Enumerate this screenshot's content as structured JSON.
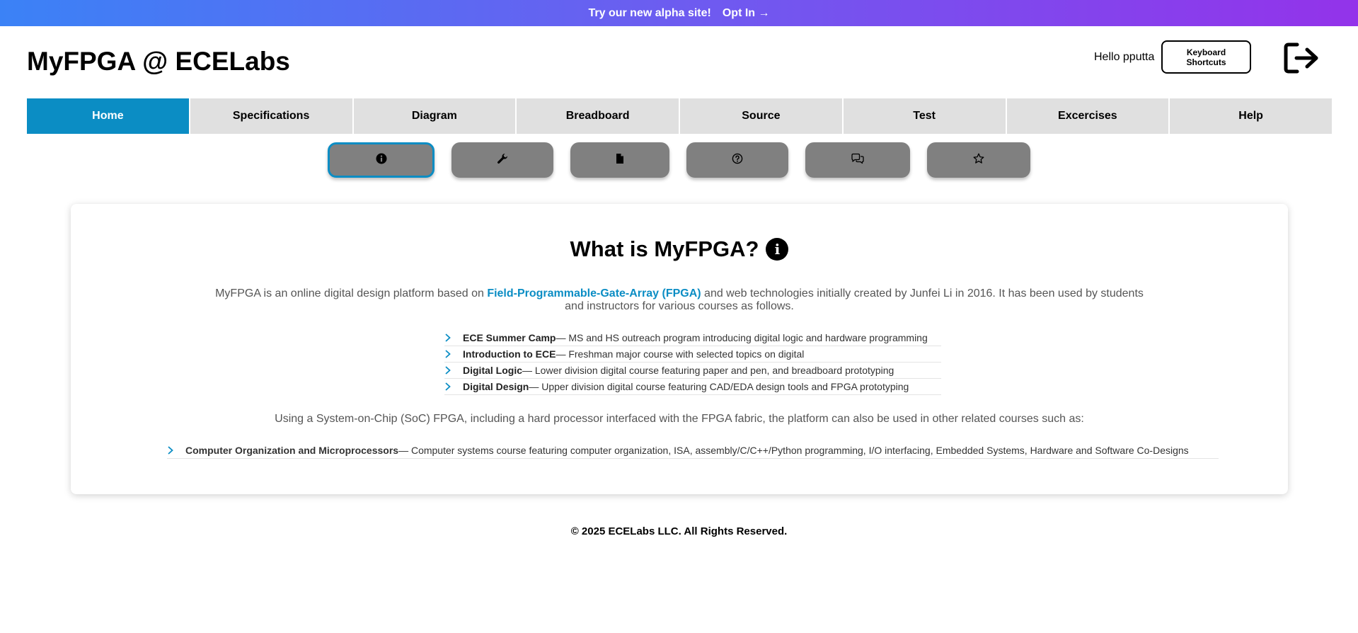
{
  "banner": {
    "text": "Try our new alpha site!",
    "link": "Opt In →",
    "colors": [
      "#3b82f6",
      "#9333ea"
    ]
  },
  "header": {
    "title": "MyFPGA @ ECELabs",
    "greeting": "Hello pputta",
    "shortcuts_label": "Keyboard Shortcuts",
    "logout_icon": "logout-icon"
  },
  "nav": {
    "active_color": "#0b8dc4",
    "tabs": [
      {
        "label": "Home",
        "active": true
      },
      {
        "label": "Specifications"
      },
      {
        "label": "Diagram"
      },
      {
        "label": "Breadboard"
      },
      {
        "label": "Source"
      },
      {
        "label": "Test"
      },
      {
        "label": "Excercises"
      },
      {
        "label": "Help"
      }
    ]
  },
  "toolbar": {
    "buttons": [
      {
        "icon": "info-icon",
        "selected": true
      },
      {
        "icon": "wrench-icon"
      },
      {
        "icon": "document-icon"
      },
      {
        "icon": "question-icon"
      },
      {
        "icon": "chat-icon"
      },
      {
        "icon": "star-icon"
      }
    ]
  },
  "main": {
    "title": "What is MyFPGA?",
    "title_icon": "info-icon",
    "intro_before": "MyFPGA is an online digital design platform based on ",
    "intro_link": "Field-Programmable-Gate-Array (FPGA)",
    "intro_after": " and web technologies initially created by Junfei Li in 2016. It has been used by students and instructors for various courses as follows.",
    "courses": [
      {
        "name": "ECE Summer Camp",
        "desc": "— MS and HS outreach program introducing digital logic and hardware programming"
      },
      {
        "name": "Introduction to ECE",
        "desc": "— Freshman major course with selected topics on digital"
      },
      {
        "name": "Digital Logic",
        "desc": "— Lower division digital course featuring paper and pen, and breadboard prototyping"
      },
      {
        "name": "Digital Design",
        "desc": "— Upper division digital course featuring CAD/EDA design tools and FPGA prototyping"
      }
    ],
    "soc_text": "Using a System-on-Chip (SoC) FPGA, including a hard processor interfaced with the FPGA fabric, the platform can also be used in other related courses such as:",
    "other_courses": [
      {
        "name": "Computer Organization and Microprocessors",
        "desc": "— Computer systems course featuring computer organization, ISA, assembly/C/C++/Python programming, I/O interfacing, Embedded Systems, Hardware and Software Co-Designs"
      }
    ]
  },
  "footer": {
    "text": "© 2025 ECELabs LLC. All Rights Reserved."
  }
}
